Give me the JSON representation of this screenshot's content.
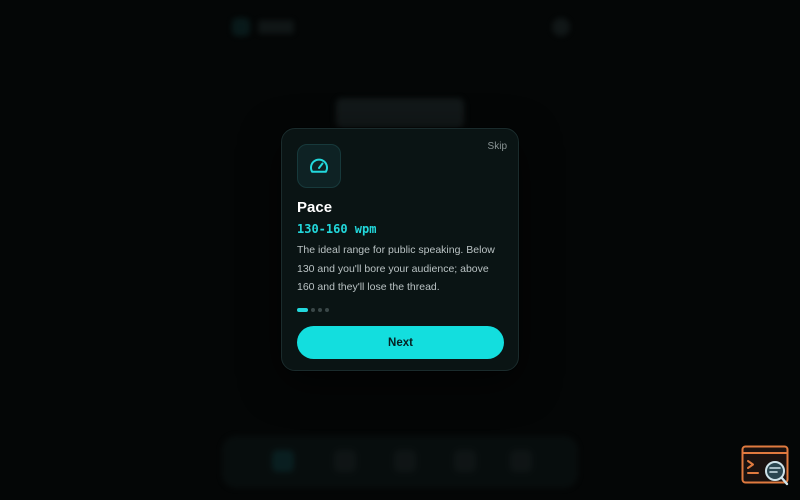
{
  "onboarding": {
    "skip_label": "Skip",
    "title": "Pace",
    "metric": "130-160 wpm",
    "description": "The ideal range for public speaking. Below 130 and you'll bore your audience; above 160 and they'll lose the thread.",
    "next_label": "Next",
    "icon": "speedometer-icon",
    "step_current": 1,
    "step_total": 4
  },
  "colors": {
    "accent": "#13dede",
    "metric_text": "#22d8dc",
    "card_bg": "#0a1414",
    "page_bg": "#040606",
    "helper_orange": "#e07a3f"
  },
  "helper_widget": {
    "icon": "terminal-search-icon"
  }
}
